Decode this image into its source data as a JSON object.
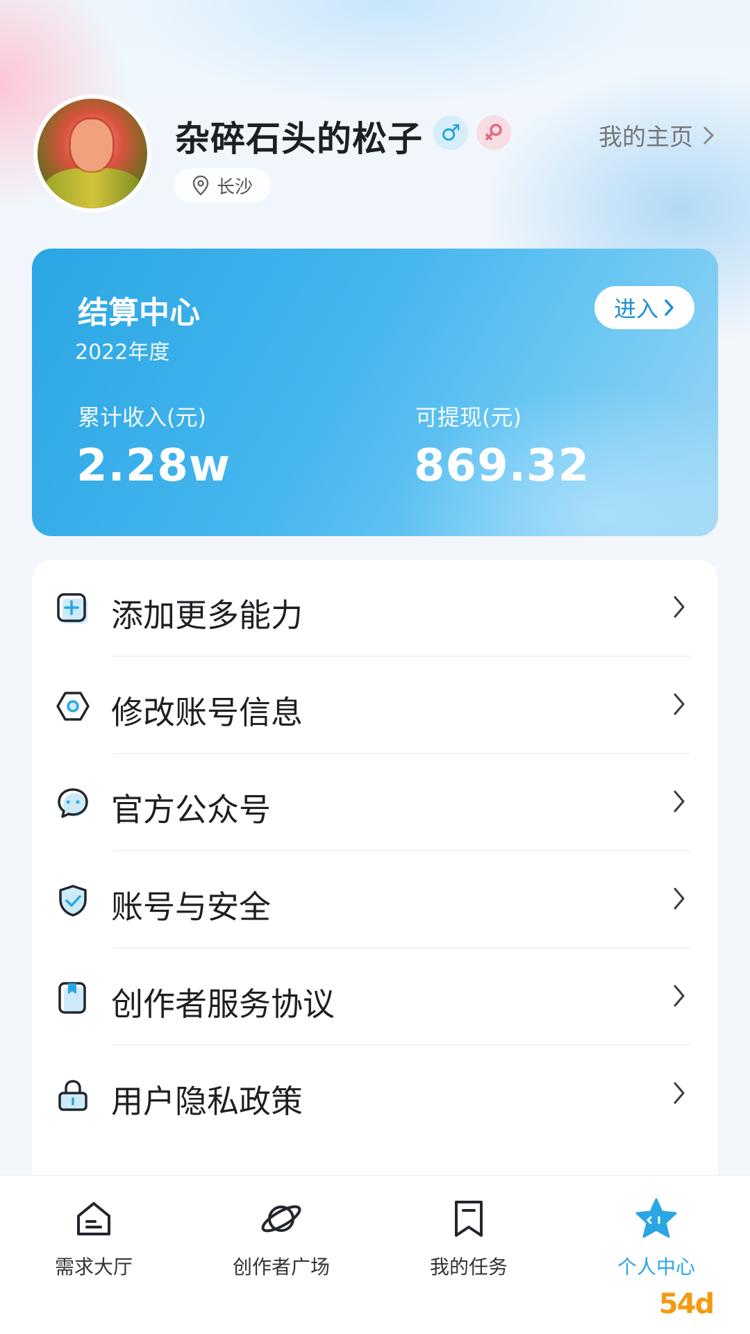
{
  "profile": {
    "username": "杂碎石头的松子",
    "male_badge": "♂",
    "female_badge": "⚲",
    "location": "长沙",
    "homepage_link": "我的主页"
  },
  "settlement": {
    "title": "结算中心",
    "year": "2022年度",
    "enter_label": "进入",
    "total_income_label": "累计收入(元)",
    "total_income_value": "2.28w",
    "withdrawable_label": "可提现(元)",
    "withdrawable_value": "869.32"
  },
  "menu": {
    "items": [
      {
        "label": "添加更多能力",
        "icon": "add-box-icon"
      },
      {
        "label": "修改账号信息",
        "icon": "hexagon-settings-icon"
      },
      {
        "label": "官方公众号",
        "icon": "chat-bubble-icon"
      },
      {
        "label": "账号与安全",
        "icon": "shield-check-icon"
      },
      {
        "label": "创作者服务协议",
        "icon": "document-bookmark-icon"
      },
      {
        "label": "用户隐私政策",
        "icon": "lock-icon"
      }
    ]
  },
  "nav": {
    "items": [
      {
        "label": "需求大厅",
        "icon": "home-icon"
      },
      {
        "label": "创作者广场",
        "icon": "planet-icon"
      },
      {
        "label": "我的任务",
        "icon": "bookmark-icon"
      },
      {
        "label": "个人中心",
        "icon": "star-icon"
      }
    ],
    "active_index": 3
  },
  "colors": {
    "accent": "#2aa6e4",
    "male": "#1f9fd6",
    "female": "#e06a7e"
  },
  "watermark": "54d"
}
